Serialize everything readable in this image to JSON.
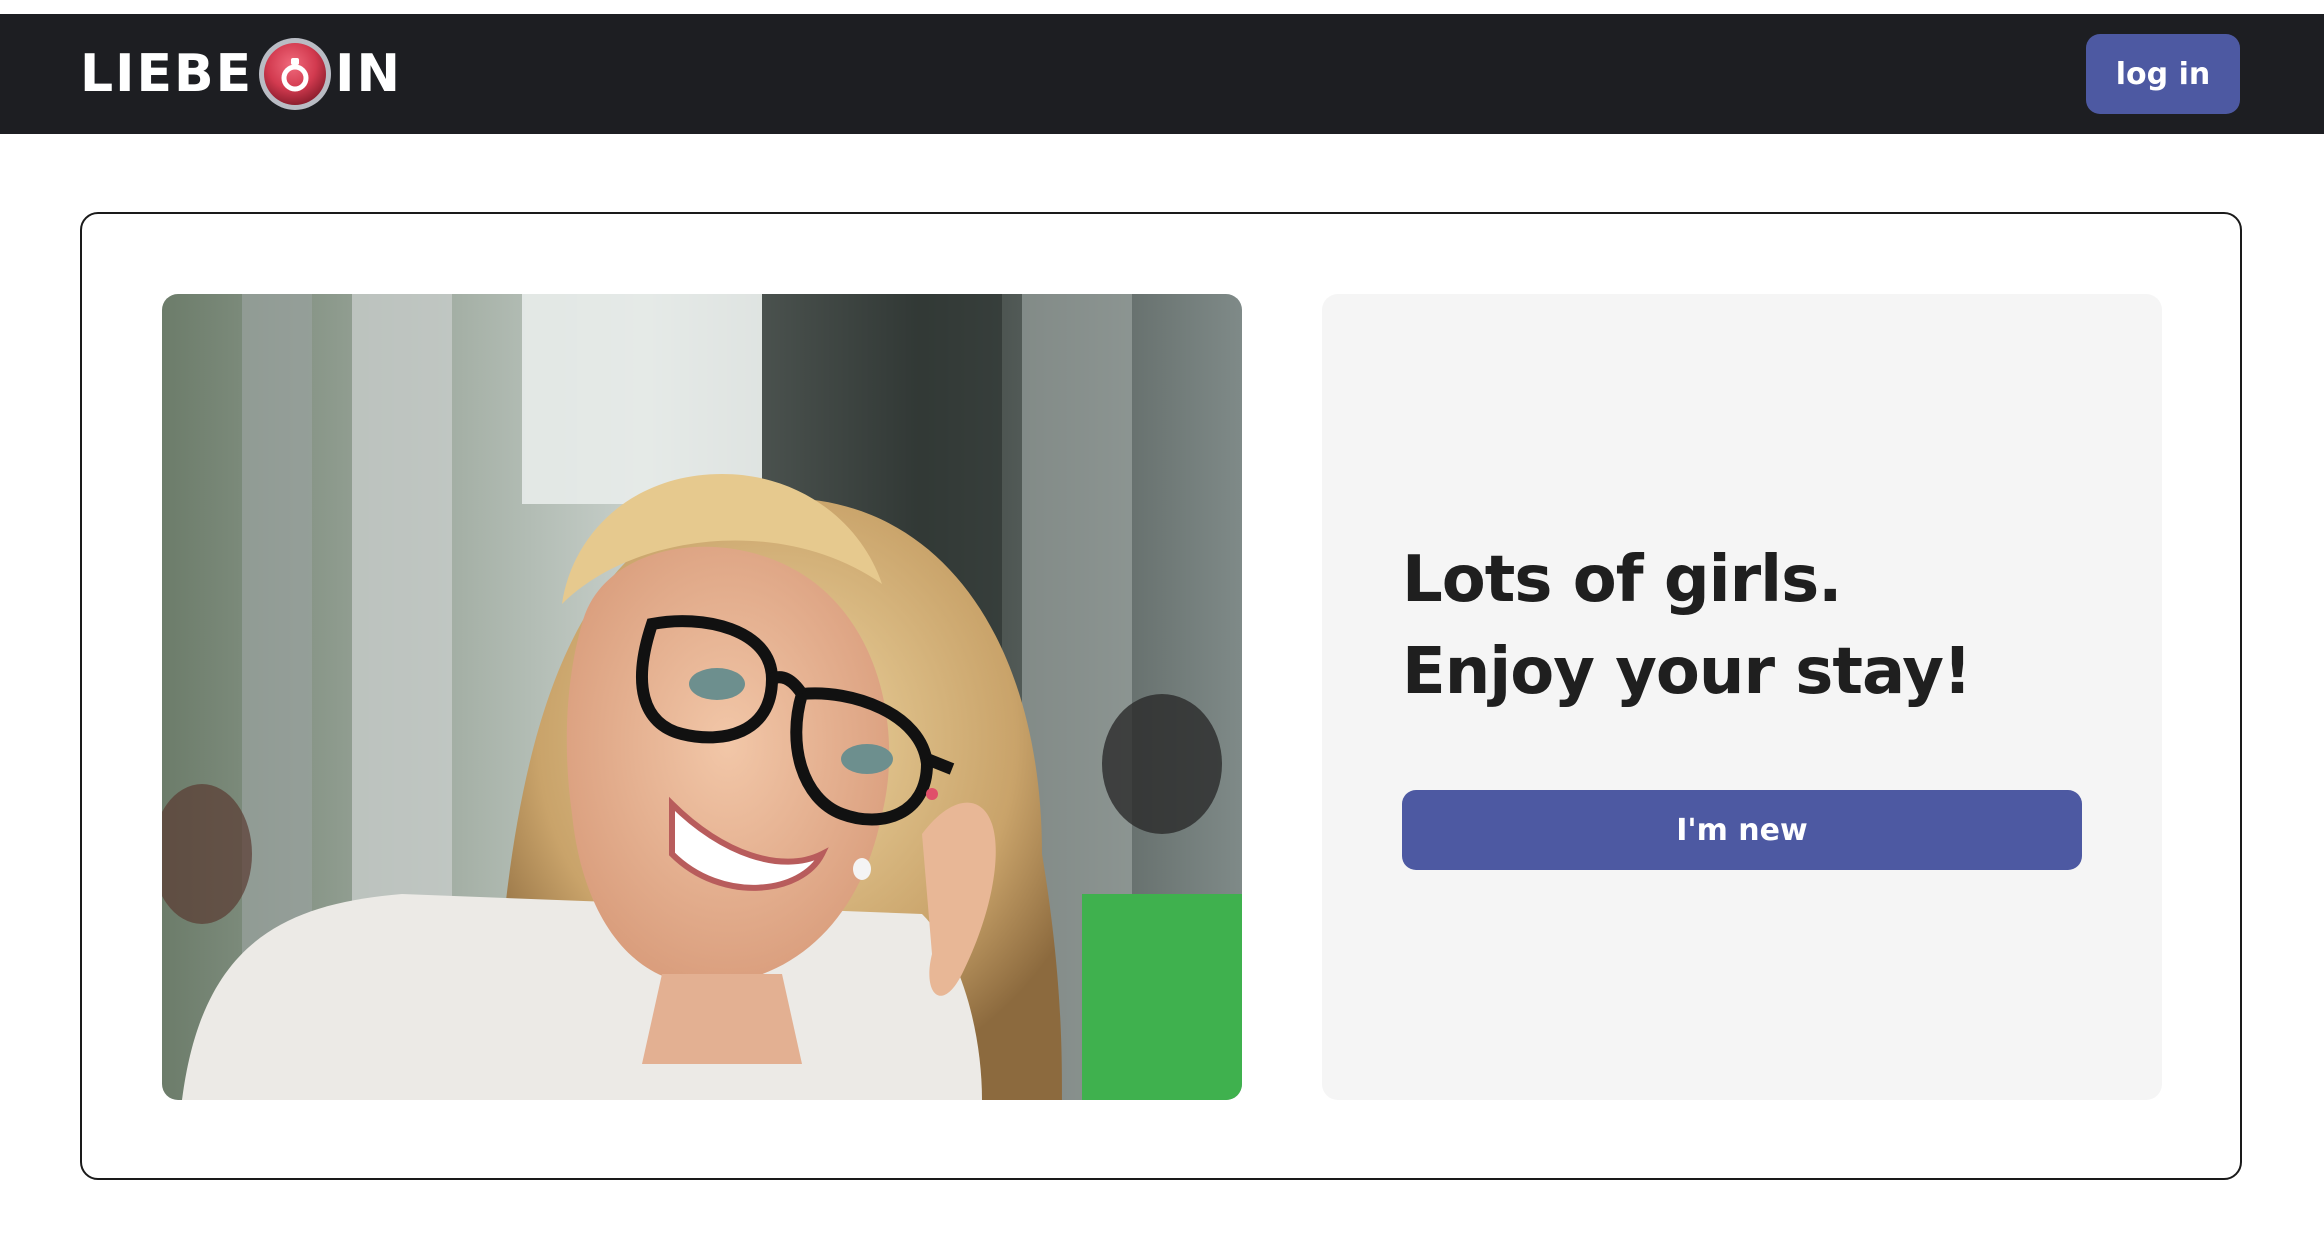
{
  "navbar": {
    "logo": {
      "text_left": "LIEBE",
      "text_right": "IN",
      "icon": "ring-icon"
    },
    "login_label": "log in"
  },
  "hero": {
    "photo": {
      "alt": "Smiling blonde woman with glasses"
    },
    "headline": "Lots of girls. Enjoy your stay!",
    "cta_label": "I'm new"
  },
  "colors": {
    "navbar_bg": "#1d1e22",
    "accent": "#4d59a2",
    "panel_bg": "#f5f5f5",
    "logo_ring": "#d23a4f"
  }
}
